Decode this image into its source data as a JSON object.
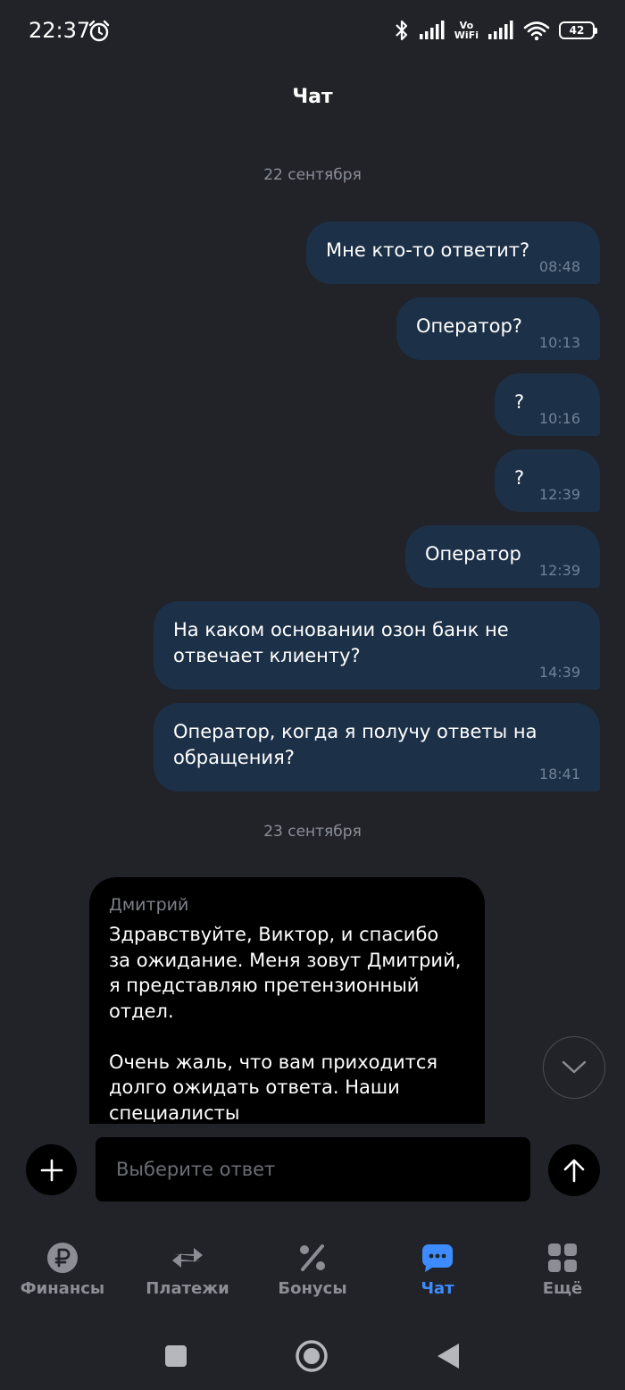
{
  "status_bar": {
    "time": "22:37",
    "vowifi_top": "Vo",
    "vowifi_bottom": "WiFi",
    "battery": "42"
  },
  "header": {
    "title": "Чат"
  },
  "chat": {
    "dates": [
      "22 сентября",
      "23 сентября"
    ],
    "outgoing": [
      {
        "text": "Мне кто-то ответит?",
        "time": "08:48"
      },
      {
        "text": "Оператор?",
        "time": "10:13"
      },
      {
        "text": "?",
        "time": "10:16"
      },
      {
        "text": "?",
        "time": "12:39"
      },
      {
        "text": "Оператор",
        "time": "12:39"
      },
      {
        "text": "На каком основании озон банк не отвечает клиенту?",
        "time": "14:39"
      },
      {
        "text": "Оператор, когда я получу ответы на обращения?",
        "time": "18:41"
      }
    ],
    "incoming": {
      "sender": "Дмитрий",
      "text": "Здравствуйте, Виктор, и спасибо за ожидание. Меня зовут Дмитрий, я представляю претензионный отдел.\n\nОчень жаль, что вам приходится долго ожидать ответа. Наши специалисты"
    }
  },
  "composer": {
    "placeholder": "Выберите ответ"
  },
  "bottom_nav": {
    "items": [
      {
        "label": "Финансы",
        "icon": "ruble-icon",
        "active": false
      },
      {
        "label": "Платежи",
        "icon": "transfer-arrows-icon",
        "active": false
      },
      {
        "label": "Бонусы",
        "icon": "percent-icon",
        "active": false
      },
      {
        "label": "Чат",
        "icon": "chat-bubble-icon",
        "active": true
      },
      {
        "label": "Ещё",
        "icon": "grid-icon",
        "active": false
      }
    ]
  },
  "colors": {
    "background": "#212329",
    "outgoing_bubble": "#1c3047",
    "incoming_bubble": "#000000",
    "accent": "#3d8bfd",
    "muted": "#8b8e95"
  }
}
